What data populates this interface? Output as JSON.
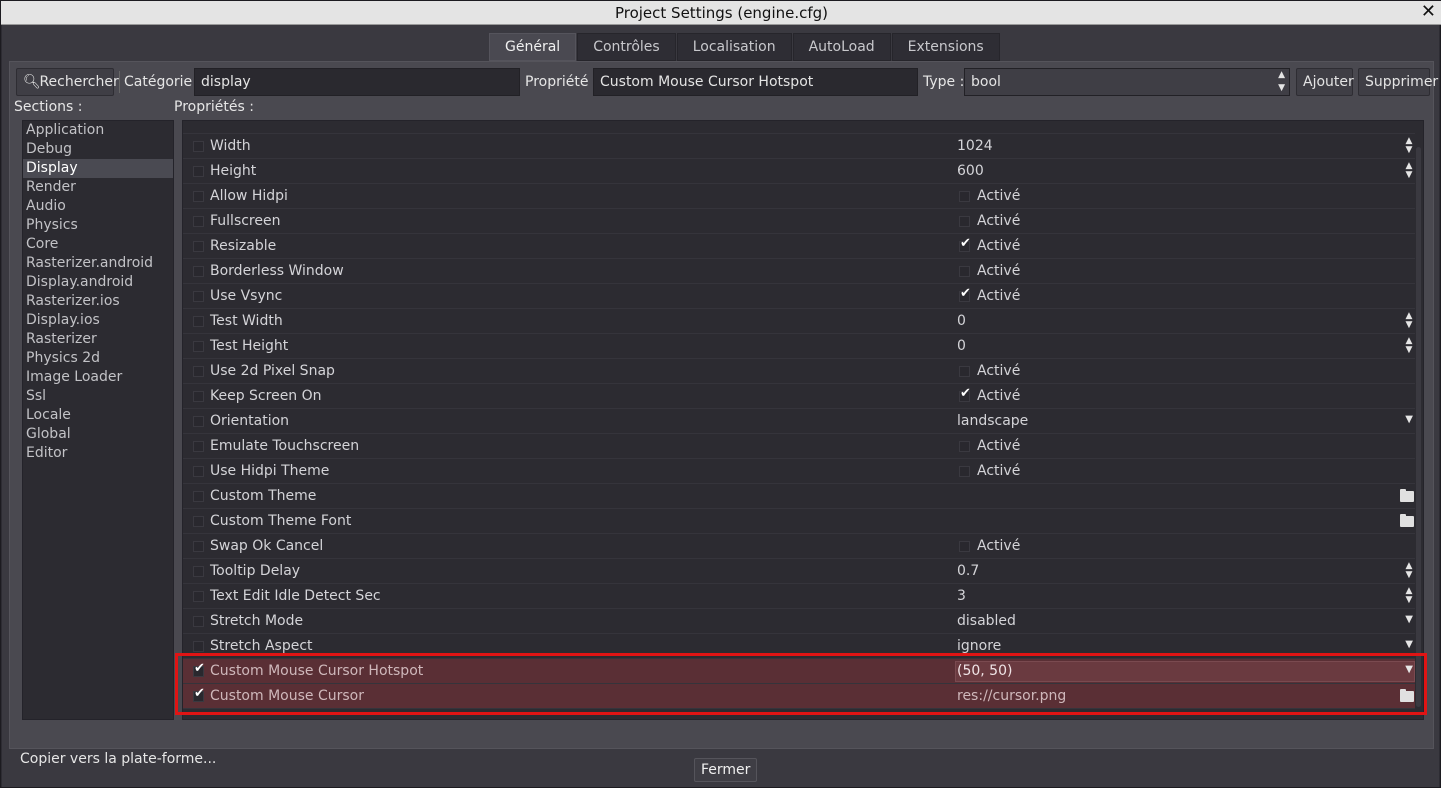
{
  "window": {
    "title": "Project Settings (engine.cfg)",
    "close_glyph": "✕"
  },
  "tabs": [
    {
      "label": "Général",
      "active": true
    },
    {
      "label": "Contrôles"
    },
    {
      "label": "Localisation"
    },
    {
      "label": "AutoLoad"
    },
    {
      "label": "Extensions"
    }
  ],
  "toolbar": {
    "search_label": "Rechercher",
    "category_label": "Catégorie :",
    "category_value": "display",
    "property_label": "Propriété :",
    "property_value": "Custom Mouse Cursor Hotspot",
    "type_label": "Type :",
    "type_value": "bool",
    "add_label": "Ajouter",
    "delete_label": "Supprimer"
  },
  "sections_title": "Sections :",
  "properties_title": "Propriétés :",
  "sections": [
    "Application",
    "Debug",
    "Display",
    "Render",
    "Audio",
    "Physics",
    "Core",
    "Rasterizer.android",
    "Display.android",
    "Rasterizer.ios",
    "Display.ios",
    "Rasterizer",
    "Physics 2d",
    "Image Loader",
    "Ssl",
    "Locale",
    "Global",
    "Editor"
  ],
  "selected_section": "Display",
  "properties": [
    {
      "name": "Width",
      "kind": "number",
      "value": "1024",
      "checked": false
    },
    {
      "name": "Height",
      "kind": "number",
      "value": "600",
      "checked": false
    },
    {
      "name": "Allow Hidpi",
      "kind": "bool",
      "value": "Activé",
      "on": false,
      "checked": false
    },
    {
      "name": "Fullscreen",
      "kind": "bool",
      "value": "Activé",
      "on": false,
      "checked": false
    },
    {
      "name": "Resizable",
      "kind": "bool",
      "value": "Activé",
      "on": true,
      "checked": false
    },
    {
      "name": "Borderless Window",
      "kind": "bool",
      "value": "Activé",
      "on": false,
      "checked": false
    },
    {
      "name": "Use Vsync",
      "kind": "bool",
      "value": "Activé",
      "on": true,
      "checked": false
    },
    {
      "name": "Test Width",
      "kind": "number",
      "value": "0",
      "checked": false
    },
    {
      "name": "Test Height",
      "kind": "number",
      "value": "0",
      "checked": false
    },
    {
      "name": "Use 2d Pixel Snap",
      "kind": "bool",
      "value": "Activé",
      "on": false,
      "checked": false
    },
    {
      "name": "Keep Screen On",
      "kind": "bool",
      "value": "Activé",
      "on": true,
      "checked": false
    },
    {
      "name": "Orientation",
      "kind": "enum",
      "value": "landscape",
      "checked": false
    },
    {
      "name": "Emulate Touchscreen",
      "kind": "bool",
      "value": "Activé",
      "on": false,
      "checked": false
    },
    {
      "name": "Use Hidpi Theme",
      "kind": "bool",
      "value": "Activé",
      "on": false,
      "checked": false
    },
    {
      "name": "Custom Theme",
      "kind": "file",
      "value": "",
      "checked": false
    },
    {
      "name": "Custom Theme Font",
      "kind": "file",
      "value": "",
      "checked": false
    },
    {
      "name": "Swap Ok Cancel",
      "kind": "bool",
      "value": "Activé",
      "on": false,
      "checked": false
    },
    {
      "name": "Tooltip Delay",
      "kind": "number",
      "value": "0.7",
      "checked": false
    },
    {
      "name": "Text Edit Idle Detect Sec",
      "kind": "number",
      "value": "3",
      "checked": false
    },
    {
      "name": "Stretch Mode",
      "kind": "enum",
      "value": "disabled",
      "checked": false
    },
    {
      "name": "Stretch Aspect",
      "kind": "enum",
      "value": "ignore",
      "checked": false
    },
    {
      "name": "Custom Mouse Cursor Hotspot",
      "kind": "enum",
      "value": "(50, 50)",
      "checked": true,
      "highlight": true,
      "boxed": true
    },
    {
      "name": "Custom Mouse Cursor",
      "kind": "file",
      "value": "res://cursor.png",
      "checked": true,
      "highlight": true
    }
  ],
  "copy_link": "Copier vers la plate-forme...",
  "close_button": "Fermer",
  "colors": {
    "highlight": "#e01414",
    "row_highlight": "#5a2f35"
  }
}
